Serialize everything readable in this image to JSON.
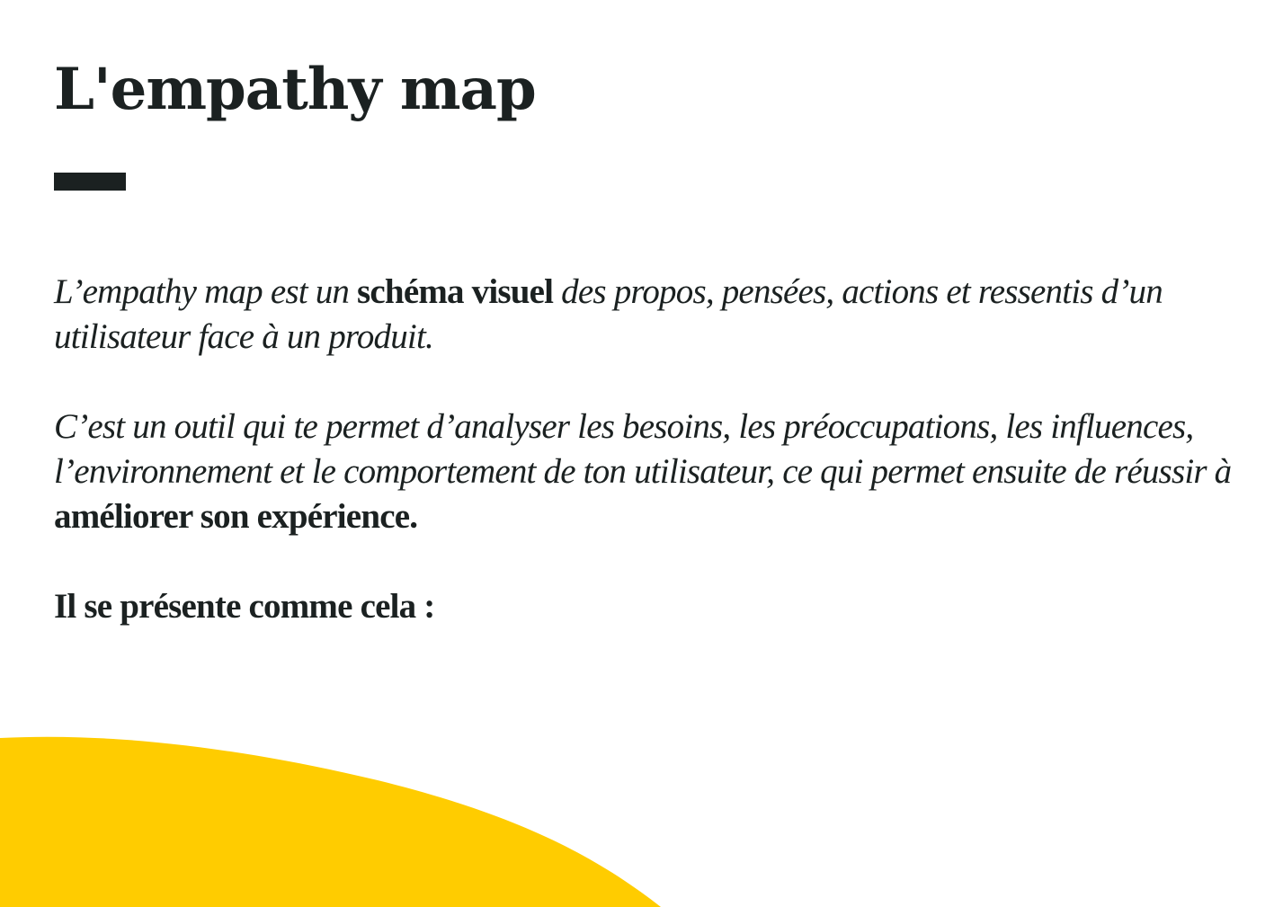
{
  "page": {
    "title": "L'empathy map",
    "paragraphs": [
      {
        "p1_a": "L’empathy map est un ",
        "p1_b": "schéma visuel",
        "p1_c": " des propos, pensées, actions et ressentis d’un utilisateur face à un produit."
      },
      {
        "p2_a": "C’est un outil qui te permet d’analyser les besoins, les préoccupations, les influences, l’environnement et le comportement de ton utilisateur, ce qui permet ensuite de réussir à ",
        "p2_b": "améliorer son expérience."
      }
    ],
    "closing": "Il se présente comme cela :"
  },
  "colors": {
    "text": "#1b2121",
    "accent": "#ffcc00"
  }
}
